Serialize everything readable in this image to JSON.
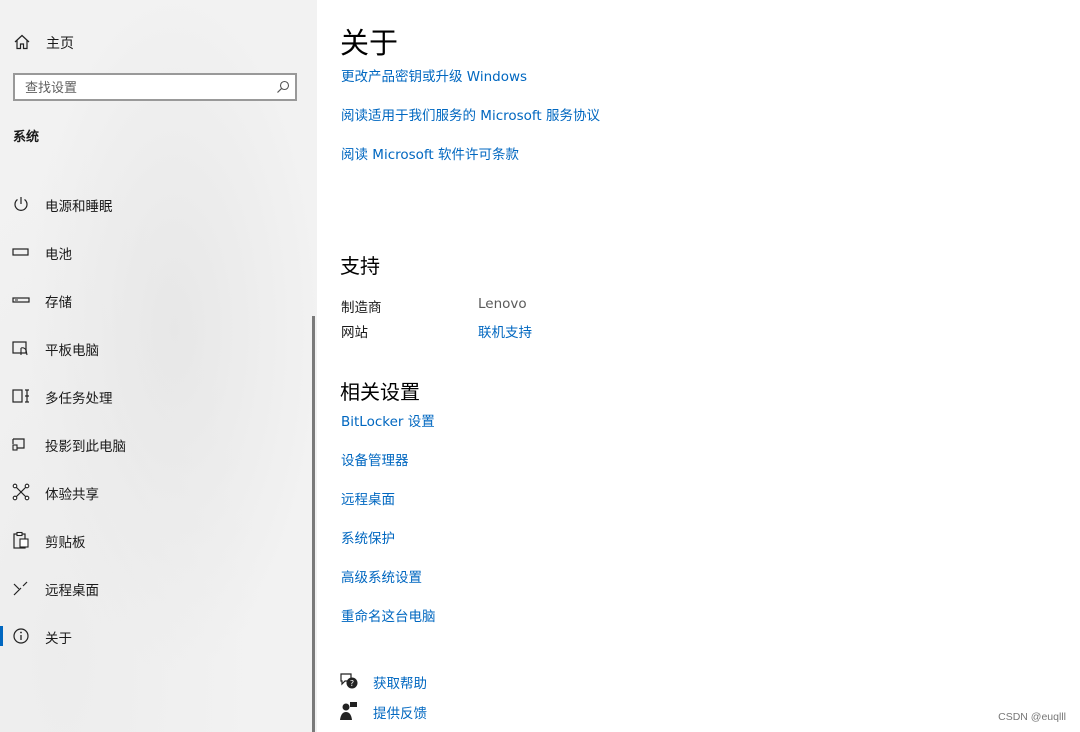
{
  "sidebar": {
    "home_label": "主页",
    "search_placeholder": "查找设置",
    "section_title": "系统",
    "items": [
      {
        "label": "电源和睡眠",
        "icon": "power-icon"
      },
      {
        "label": "电池",
        "icon": "battery-icon"
      },
      {
        "label": "存储",
        "icon": "storage-icon"
      },
      {
        "label": "平板电脑",
        "icon": "tablet-icon"
      },
      {
        "label": "多任务处理",
        "icon": "multitasking-icon"
      },
      {
        "label": "投影到此电脑",
        "icon": "projecting-icon"
      },
      {
        "label": "体验共享",
        "icon": "shared-experiences-icon"
      },
      {
        "label": "剪贴板",
        "icon": "clipboard-icon"
      },
      {
        "label": "远程桌面",
        "icon": "remote-desktop-icon"
      },
      {
        "label": "关于",
        "icon": "info-icon",
        "selected": true
      }
    ]
  },
  "main": {
    "title": "关于",
    "top_links": [
      "更改产品密钥或升级 Windows",
      "阅读适用于我们服务的 Microsoft 服务协议",
      "阅读 Microsoft 软件许可条款"
    ],
    "support": {
      "heading": "支持",
      "manufacturer_label": "制造商",
      "manufacturer_value": "Lenovo",
      "website_label": "网站",
      "website_link": "联机支持"
    },
    "related": {
      "heading": "相关设置",
      "links": [
        "BitLocker 设置",
        "设备管理器",
        "远程桌面",
        "系统保护",
        "高级系统设置",
        "重命名这台电脑"
      ]
    },
    "help": {
      "get_help": "获取帮助",
      "give_feedback": "提供反馈"
    }
  },
  "watermark": "CSDN @euqlll",
  "colors": {
    "accent": "#0067c0",
    "sidebar_bg": "#f2f2f2"
  }
}
